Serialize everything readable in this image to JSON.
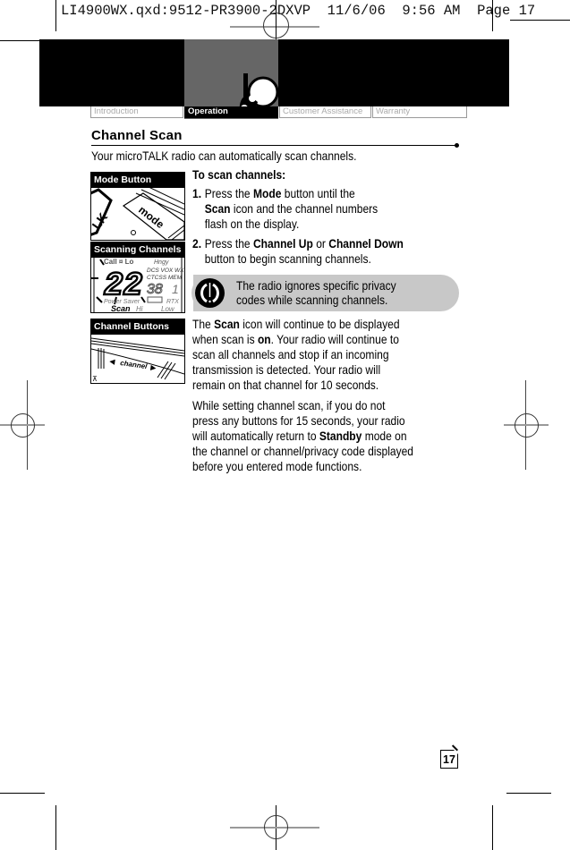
{
  "slug": "LI4900WX.qxd:9512-PR3900-2DXVP  11/6/06  9:56 AM  Page 17",
  "nav": {
    "tabs": [
      {
        "label": "Introduction",
        "active": false
      },
      {
        "label": "Operation",
        "active": true
      },
      {
        "label": "Customer Assistance",
        "active": false
      },
      {
        "label": "Warranty",
        "active": false
      }
    ],
    "header_icon": "radio-operation-icon"
  },
  "section": {
    "title": "Channel Scan",
    "intro": "Your microTALK radio can automatically scan channels."
  },
  "figures": [
    {
      "label": "Mode Button",
      "illustration": "mode-button-illustration",
      "button_text": "mode"
    },
    {
      "label": "Scanning Channels",
      "illustration": "lcd-display-illustration",
      "display": {
        "channel": "22",
        "code": "38",
        "sub": "1",
        "labels": [
          "DCS",
          "VOX",
          "WX",
          "CTCSS",
          "MEM",
          "Power",
          "Saver",
          "RTX",
          "Scan",
          "Hi",
          "Low"
        ]
      }
    },
    {
      "label": "Channel Buttons",
      "illustration": "channel-buttons-illustration",
      "button_text": "channel"
    }
  ],
  "instructions": {
    "heading": "To scan channels:",
    "steps": [
      {
        "num": "1.",
        "parts": [
          [
            "Press the ",
            false
          ],
          [
            "Mode",
            true
          ],
          [
            " button until the",
            false
          ]
        ],
        "line2": [
          [
            "Scan",
            true
          ],
          [
            " icon and the channel numbers",
            false
          ]
        ],
        "line3": "flash on the display."
      },
      {
        "num": "2.",
        "parts": [
          [
            "Press the ",
            false
          ],
          [
            "Channel Up",
            true
          ],
          [
            " or ",
            false
          ],
          [
            "Channel Down",
            true
          ]
        ],
        "line2": [
          [
            "button to begin scanning channels.",
            false
          ]
        ]
      }
    ]
  },
  "note": {
    "icon": "info-note-icon",
    "lines": [
      "The radio ignores specific privacy",
      "codes while scanning channels."
    ]
  },
  "paragraphs": [
    {
      "lines": [
        [
          [
            "The ",
            false
          ],
          [
            "Scan",
            true
          ],
          [
            " icon will continue to be displayed",
            false
          ]
        ],
        [
          [
            "when scan is ",
            false
          ],
          [
            "on",
            true
          ],
          [
            ". Your radio will continue to",
            false
          ]
        ],
        [
          [
            "scan all channels and stop if an incoming",
            false
          ]
        ],
        [
          [
            "transmission is detected. Your radio will",
            false
          ]
        ],
        [
          [
            "remain on that channel for 10 seconds.",
            false
          ]
        ]
      ]
    },
    {
      "lines": [
        [
          [
            "While setting channel scan, if you do not",
            false
          ]
        ],
        [
          [
            "press any buttons for 15 seconds, your radio",
            false
          ]
        ],
        [
          [
            "will automatically return to ",
            false
          ],
          [
            "Standby",
            true
          ],
          [
            " mode on",
            false
          ]
        ],
        [
          [
            "the channel or channel/privacy code displayed",
            false
          ]
        ],
        [
          [
            "before you entered mode functions.",
            false
          ]
        ]
      ]
    }
  ],
  "page_number": "17"
}
